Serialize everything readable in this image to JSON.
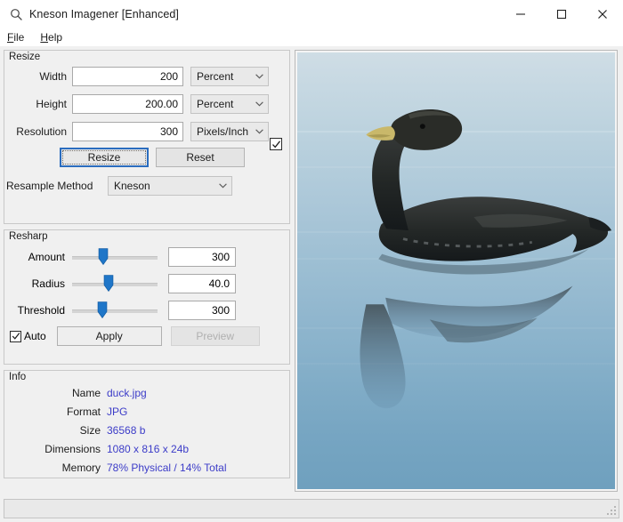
{
  "window": {
    "title": "Kneson Imagener [Enhanced]",
    "title_icon": "magnifier-icon",
    "controls": {
      "minimize": "minimize-icon",
      "maximize": "maximize-icon",
      "close": "close-icon"
    }
  },
  "menubar": {
    "items": [
      {
        "label": "File",
        "accel": "F"
      },
      {
        "label": "Help",
        "accel": "H"
      }
    ]
  },
  "resize": {
    "group_title": "Resize",
    "width": {
      "label": "Width",
      "value": "200",
      "unit": "Percent"
    },
    "height": {
      "label": "Height",
      "value": "200.00",
      "unit": "Percent"
    },
    "resolution": {
      "label": "Resolution",
      "value": "300",
      "unit": "Pixels/Inch"
    },
    "aspect_lock": {
      "name": "aspect-ratio-checkbox",
      "checked": true
    },
    "resize_button": "Resize",
    "reset_button": "Reset",
    "resample": {
      "label": "Resample Method",
      "value": "Kneson"
    }
  },
  "resharp": {
    "group_title": "Resharp",
    "sliders": [
      {
        "label": "Amount",
        "value": "300",
        "pos": 36
      },
      {
        "label": "Radius",
        "value": "40.0",
        "pos": 43
      },
      {
        "label": "Threshold",
        "value": "300",
        "pos": 35
      }
    ],
    "auto": {
      "label": "Auto",
      "checked": true
    },
    "apply_button": "Apply",
    "preview_button": "Preview",
    "preview_disabled": true
  },
  "info": {
    "group_title": "Info",
    "rows": [
      {
        "key": "Name",
        "value": "duck.jpg"
      },
      {
        "key": "Format",
        "value": "JPG"
      },
      {
        "key": "Size",
        "value": "36568 b"
      },
      {
        "key": "Dimensions",
        "value": "1080 x 816 x 24b"
      },
      {
        "key": "Memory",
        "value": "78% Physical / 14% Total"
      }
    ]
  },
  "image_panel": {
    "name": "image-preview",
    "subject": "duck swimming on water with reflection"
  },
  "statusbar": {
    "text": ""
  },
  "colors": {
    "accent": "#2b6dbf",
    "info_value": "#3c3cc8",
    "slider_thumb": "#1f76c8",
    "window_bg": "#f0f0f0",
    "water_top": "#cfdde5",
    "water_bottom": "#6fa0be"
  }
}
